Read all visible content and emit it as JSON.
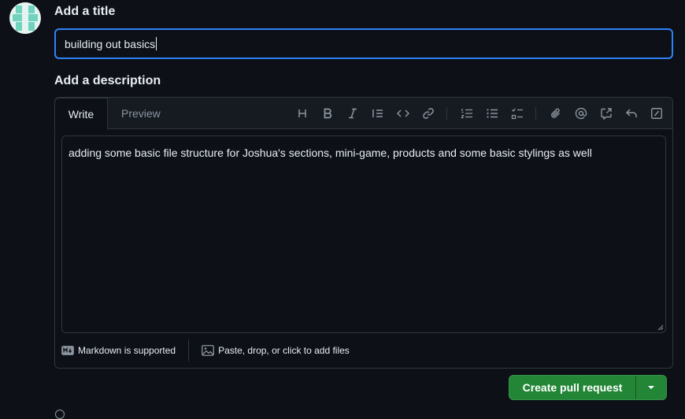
{
  "title_section": {
    "heading": "Add a title",
    "value": "building out basics"
  },
  "description_section": {
    "heading": "Add a description",
    "tabs": [
      {
        "label": "Write",
        "active": true
      },
      {
        "label": "Preview",
        "active": false
      }
    ],
    "toolbar": [
      "heading-icon",
      "bold-icon",
      "italic-icon",
      "quote-icon",
      "code-icon",
      "link-icon",
      "ordered-list-icon",
      "unordered-list-icon",
      "task-list-icon",
      "attach-icon",
      "mention-icon",
      "reference-icon",
      "reply-icon",
      "slash-command-icon"
    ],
    "body": "adding some basic file structure for Joshua's sections, mini-game, products and some basic stylings as well",
    "markdown_note": "Markdown is supported",
    "attach_note": "Paste, drop, or click to add files"
  },
  "actions": {
    "create_label": "Create pull request"
  },
  "colors": {
    "background": "#0d1117",
    "focus_border": "#2f81f7",
    "primary_button": "#238636",
    "muted_text": "#8b949e"
  }
}
